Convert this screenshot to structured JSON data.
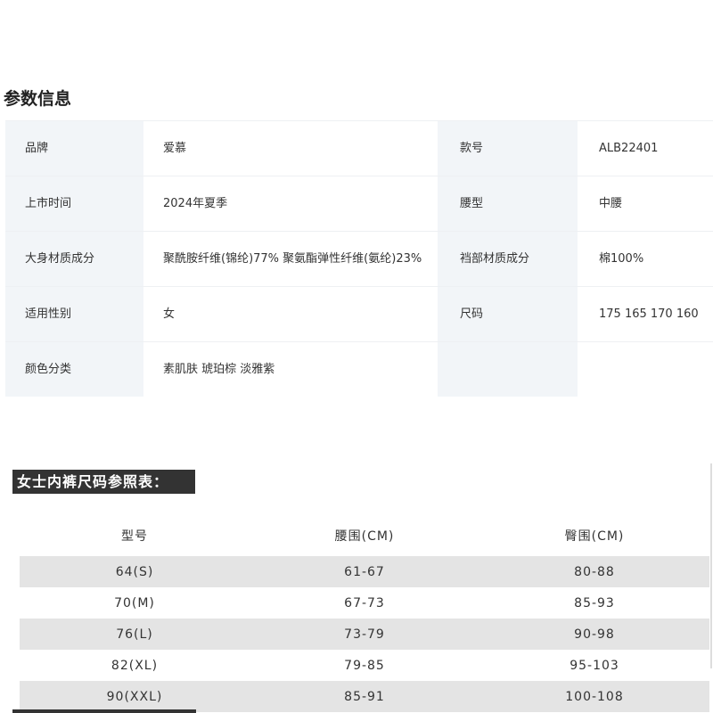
{
  "params_section": {
    "title": "参数信息",
    "rows": [
      {
        "k1": "品牌",
        "v1": "爱慕",
        "k2": "款号",
        "v2": "ALB22401"
      },
      {
        "k1": "上市时间",
        "v1": "2024年夏季",
        "k2": "腰型",
        "v2": "中腰"
      },
      {
        "k1": "大身材质成分",
        "v1": "聚酰胺纤维(锦纶)77% 聚氨酯弹性纤维(氨纶)23%",
        "k2": "裆部材质成分",
        "v2": "棉100%"
      },
      {
        "k1": "适用性别",
        "v1": "女",
        "k2": "尺码",
        "v2": "175 165 170 160"
      },
      {
        "k1": "颜色分类",
        "v1": "素肌肤 琥珀棕 淡雅紫",
        "k2": "",
        "v2": ""
      }
    ]
  },
  "size_chart": {
    "title": "女士内裤尺码参照表：",
    "headers": [
      "型号",
      "腰围(CM)",
      "臀围(CM)"
    ],
    "rows": [
      [
        "64(S)",
        "61-67",
        "80-88"
      ],
      [
        "70(M)",
        "67-73",
        "85-93"
      ],
      [
        "76(L)",
        "73-79",
        "90-98"
      ],
      [
        "82(XL)",
        "79-85",
        "95-103"
      ],
      [
        "90(XXL)",
        "85-91",
        "100-108"
      ]
    ]
  }
}
